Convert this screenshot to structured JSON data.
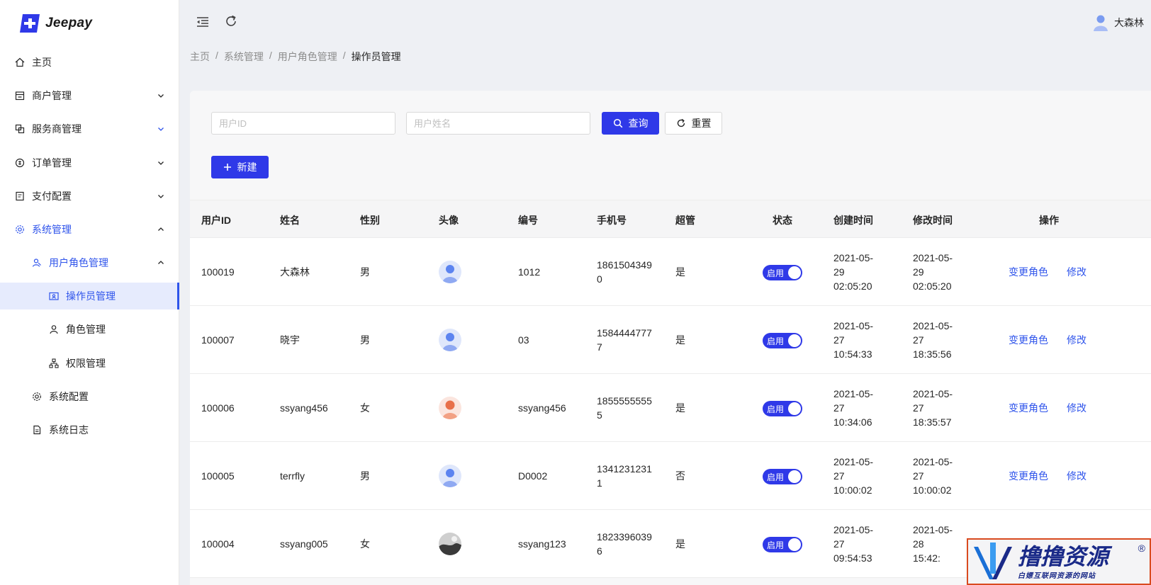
{
  "app": {
    "logo_text": "Jeepay"
  },
  "sidebar": {
    "items": [
      {
        "label": "主页",
        "icon": "home-icon"
      },
      {
        "label": "商户管理",
        "icon": "shop-icon"
      },
      {
        "label": "服务商管理",
        "icon": "block-icon"
      },
      {
        "label": "订单管理",
        "icon": "order-icon"
      },
      {
        "label": "支付配置",
        "icon": "pay-config-icon"
      },
      {
        "label": "系统管理",
        "icon": "gear-icon"
      },
      {
        "label": "用户角色管理",
        "icon": "team-icon"
      },
      {
        "label": "操作员管理",
        "icon": "contacts-icon"
      },
      {
        "label": "角色管理",
        "icon": "user-icon"
      },
      {
        "label": "权限管理",
        "icon": "cluster-icon"
      },
      {
        "label": "系统配置",
        "icon": "setting-icon"
      },
      {
        "label": "系统日志",
        "icon": "file-icon"
      }
    ]
  },
  "header": {
    "user_name": "大森林"
  },
  "breadcrumb": [
    "主页",
    "系统管理",
    "用户角色管理",
    "操作员管理"
  ],
  "search": {
    "user_id_placeholder": "用户ID",
    "user_name_placeholder": "用户姓名",
    "query_label": "查询",
    "reset_label": "重置",
    "new_label": "新建"
  },
  "table": {
    "columns": [
      "用户ID",
      "姓名",
      "性别",
      "头像",
      "编号",
      "手机号",
      "超管",
      "状态",
      "创建时间",
      "修改时间",
      "操作"
    ],
    "switch_label": "启用",
    "change_role_label": "变更角色",
    "edit_label": "修改",
    "rows": [
      {
        "id": "100019",
        "name": "大森林",
        "gender": "男",
        "avatar": "male",
        "code": "1012",
        "phone": "18615043490",
        "super": "是",
        "created_date": "2021-05-",
        "created_day": "29",
        "created_time": "02:05:20",
        "modified_date": "2021-05-",
        "modified_day": "29",
        "modified_time": "02:05:20"
      },
      {
        "id": "100007",
        "name": "晓宇",
        "gender": "男",
        "avatar": "male",
        "code": "03",
        "phone": "15844447777",
        "super": "是",
        "created_date": "2021-05-",
        "created_day": "27",
        "created_time": "10:54:33",
        "modified_date": "2021-05-",
        "modified_day": "27",
        "modified_time": "18:35:56"
      },
      {
        "id": "100006",
        "name": "ssyang456",
        "gender": "女",
        "avatar": "female",
        "code": "ssyang456",
        "phone": "18555555555",
        "super": "是",
        "created_date": "2021-05-",
        "created_day": "27",
        "created_time": "10:34:06",
        "modified_date": "2021-05-",
        "modified_day": "27",
        "modified_time": "18:35:57"
      },
      {
        "id": "100005",
        "name": "terrfly",
        "gender": "男",
        "avatar": "male",
        "code": "D0002",
        "phone": "13412312311",
        "super": "否",
        "created_date": "2021-05-",
        "created_day": "27",
        "created_time": "10:00:02",
        "modified_date": "2021-05-",
        "modified_day": "27",
        "modified_time": "10:00:02"
      },
      {
        "id": "100004",
        "name": "ssyang005",
        "gender": "女",
        "avatar": "photo",
        "code": "ssyang123",
        "phone": "18233960396",
        "super": "是",
        "created_date": "2021-05-",
        "created_day": "27",
        "created_time": "09:54:53",
        "modified_date": "2021-05-",
        "modified_day": "28",
        "modified_time": "15:42:"
      }
    ]
  },
  "watermark": {
    "title": "撸撸资源",
    "subtitle": "白嫖互联网资源的网站",
    "reg": "®"
  },
  "colors": {
    "primary": "#2f39e8",
    "link": "#2f54eb"
  }
}
